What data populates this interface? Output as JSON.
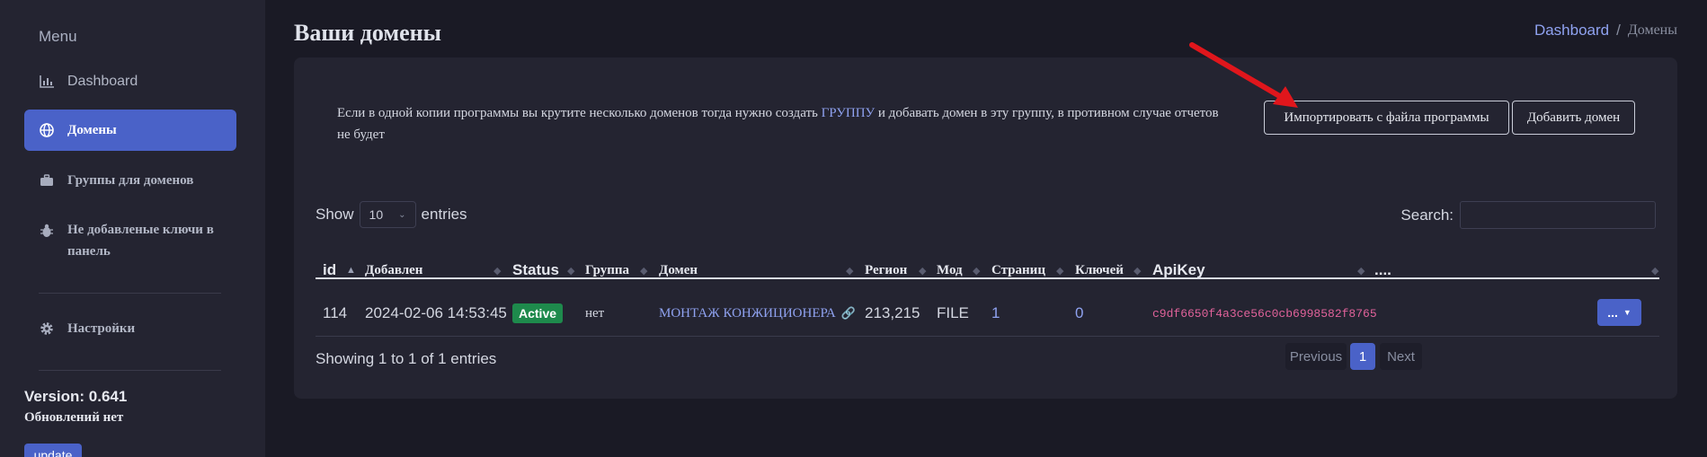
{
  "sidebar": {
    "menu_title": "Menu",
    "items": [
      {
        "label": "Dashboard",
        "icon": "chart-icon"
      },
      {
        "label": "Домены",
        "icon": "globe-icon"
      },
      {
        "label": "Группы для доменов",
        "icon": "briefcase-icon"
      },
      {
        "label": "Не добавленые ключи в панель",
        "icon": "bug-icon"
      },
      {
        "label": "Настройки",
        "icon": "gear-icon"
      }
    ],
    "version": "Version: 0.641",
    "updates_status": "Обновлений нет",
    "update_button": "update"
  },
  "header": {
    "title": "Ваши домены",
    "breadcrumb": {
      "home": "Dashboard",
      "separator": "/",
      "current": "Домены"
    }
  },
  "card": {
    "info_before": "Если в одной копии программы вы крутите несколько доменов тогда нужно создать ",
    "info_link": "ГРУППУ",
    "info_after": " и добавать домен в эту группу, в противном случае отчетов не будет",
    "import_button": "Импортировать с файла программы",
    "add_button": "Добавить домен"
  },
  "table_controls": {
    "show_label": "Show",
    "page_length": "10",
    "entries_label": "entries",
    "search_label": "Search:",
    "search_value": ""
  },
  "table": {
    "columns": [
      "id",
      "Добавлен",
      "Status",
      "Группа",
      "Домен",
      "Регион",
      "Мод",
      "Страниц",
      "Ключей",
      "ApiKey",
      "...."
    ],
    "rows": [
      {
        "id": "114",
        "added": "2024-02-06 14:53:45",
        "status": "Active",
        "group": "нет",
        "domain": "МОНТАЖ КОНЖИЦИОНЕРА",
        "region": "213,215",
        "mod": "FILE",
        "pages": "1",
        "keys": "0",
        "apikey": "c9df6650f4a3ce56c0cb6998582f8765",
        "actions": "..."
      }
    ]
  },
  "footer": {
    "showing": "Showing 1 to 1 of 1 entries",
    "previous": "Previous",
    "page": "1",
    "next": "Next"
  },
  "colors": {
    "accent": "#4a62c8",
    "active_badge": "#1e8a4c",
    "link": "#8fa2f0",
    "apikey": "#e0629a",
    "annotation_arrow": "#e0161c"
  }
}
